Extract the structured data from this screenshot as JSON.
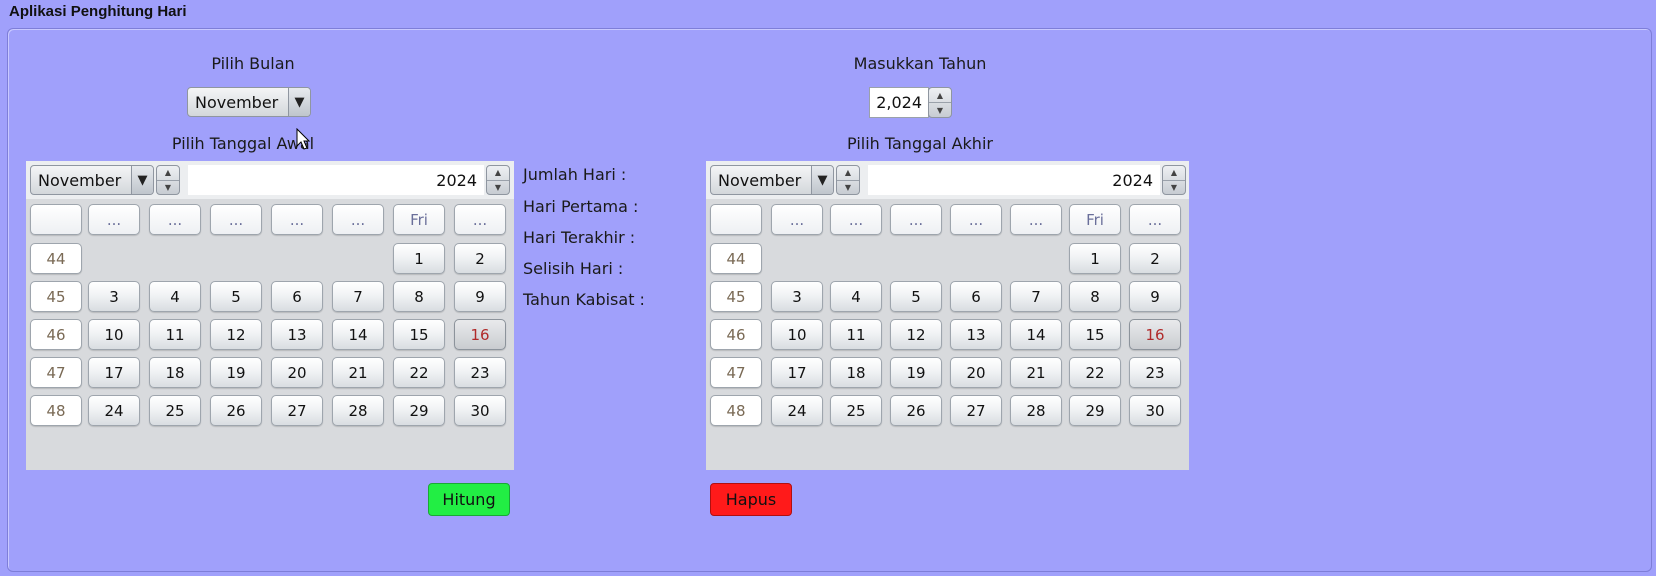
{
  "window": {
    "title": "Aplikasi Penghitung Hari"
  },
  "left": {
    "month_label": "Pilih Bulan",
    "month_value": "November",
    "start_label": "Pilih Tanggal Awal"
  },
  "right": {
    "year_label": "Masukkan Tahun",
    "year_value": "2,024",
    "end_label": "Pilih Tanggal Akhir"
  },
  "results": {
    "jumlah_hari": "Jumlah Hari :",
    "hari_pertama": "Hari Pertama :",
    "hari_terakhir": "Hari Terakhir :",
    "selisih_hari": "Selisih Hari :",
    "tahun_kabisat": "Tahun Kabisat :"
  },
  "calendar": {
    "month": "November",
    "year": "2024",
    "headers": [
      "",
      "...",
      "...",
      "...",
      "...",
      "...",
      "Fri",
      "..."
    ],
    "weeks": [
      {
        "num": "44",
        "days": [
          "",
          "",
          "",
          "",
          "",
          "1",
          "2"
        ]
      },
      {
        "num": "45",
        "days": [
          "3",
          "4",
          "5",
          "6",
          "7",
          "8",
          "9"
        ]
      },
      {
        "num": "46",
        "days": [
          "10",
          "11",
          "12",
          "13",
          "14",
          "15",
          "16"
        ]
      },
      {
        "num": "47",
        "days": [
          "17",
          "18",
          "19",
          "20",
          "21",
          "22",
          "23"
        ]
      },
      {
        "num": "48",
        "days": [
          "24",
          "25",
          "26",
          "27",
          "28",
          "29",
          "30"
        ]
      }
    ],
    "today": "16"
  },
  "buttons": {
    "hitung": "Hitung",
    "hapus": "Hapus"
  },
  "colors": {
    "background": "#a0a0fb",
    "hitung": "#22ee44",
    "hapus": "#ff1a1a",
    "today_text": "#b02a2a"
  }
}
